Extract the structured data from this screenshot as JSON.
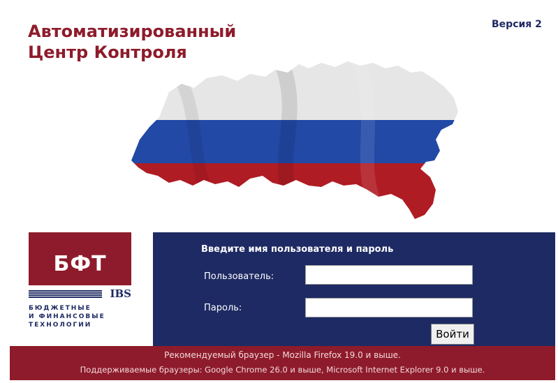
{
  "header": {
    "title_line1": "Автоматизированный",
    "title_line2": "Центр Контроля",
    "version": "Версия 2"
  },
  "logo": {
    "brand": "БФТ",
    "ibs": "IBS",
    "line1": "БЮДЖЕТНЫЕ",
    "line2": "И ФИНАНСОВЫЕ",
    "line3": "ТЕХНОЛОГИИ"
  },
  "login": {
    "heading": "Введите имя пользователя и пароль",
    "user_label": "Пользователь:",
    "user_value": "",
    "password_label": "Пароль:",
    "password_value": "",
    "submit_label": "Войти"
  },
  "footer": {
    "recommended": "Рекомендуемый браузер - Mozilla Firefox 19.0 и выше.",
    "supported": "Поддерживаемые браузеры: Google Chrome 26.0 и выше, Microsoft Internet Explorer 9.0 и выше."
  },
  "colors": {
    "brand_red": "#8e1b2b",
    "brand_blue": "#1e2a63",
    "flag_white": "#e6e6e6",
    "flag_blue": "#2349a6",
    "flag_red": "#b01c24"
  },
  "icons": {
    "map": "russia-flag-map-icon",
    "logo": "bft-ibs-logo"
  }
}
